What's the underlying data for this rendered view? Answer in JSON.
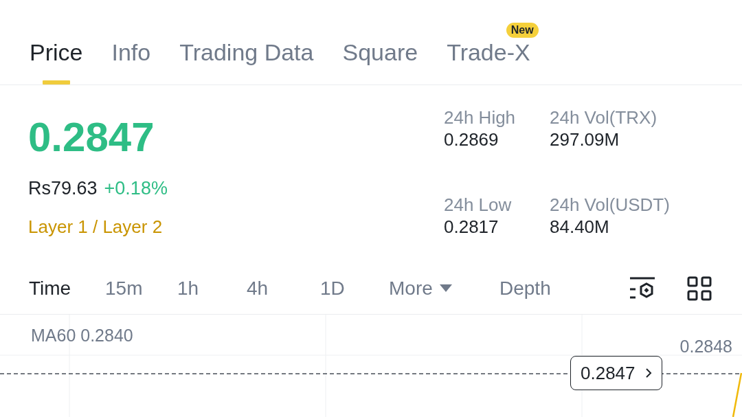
{
  "tabs": [
    {
      "label": "Price",
      "selected": true
    },
    {
      "label": "Info",
      "selected": false
    },
    {
      "label": "Trading Data",
      "selected": false
    },
    {
      "label": "Square",
      "selected": false
    },
    {
      "label": "Trade-X",
      "selected": false,
      "badge": "New"
    }
  ],
  "price": {
    "last": "0.2847",
    "fiat": "Rs79.63",
    "change": "+0.18%",
    "category": "Layer 1 / Layer 2"
  },
  "stats": [
    {
      "label": "24h High",
      "value": "0.2869"
    },
    {
      "label": "24h Vol(TRX)",
      "value": "297.09M"
    },
    {
      "label": "24h Low",
      "value": "0.2817"
    },
    {
      "label": "24h Vol(USDT)",
      "value": "84.40M"
    }
  ],
  "intervals": [
    {
      "label": "Time",
      "selected": true,
      "kind": "text"
    },
    {
      "label": "15m",
      "selected": false,
      "kind": "text"
    },
    {
      "label": "1h",
      "selected": false,
      "kind": "text"
    },
    {
      "label": "4h",
      "selected": false,
      "kind": "text"
    },
    {
      "label": "1D",
      "selected": false,
      "kind": "text"
    },
    {
      "label": "More",
      "selected": false,
      "kind": "dropdown"
    },
    {
      "label": "Depth",
      "selected": false,
      "kind": "text"
    }
  ],
  "chart": {
    "ma_label": "MA60 0.2840",
    "axis_label": "0.2848",
    "last_price": "0.2847"
  }
}
